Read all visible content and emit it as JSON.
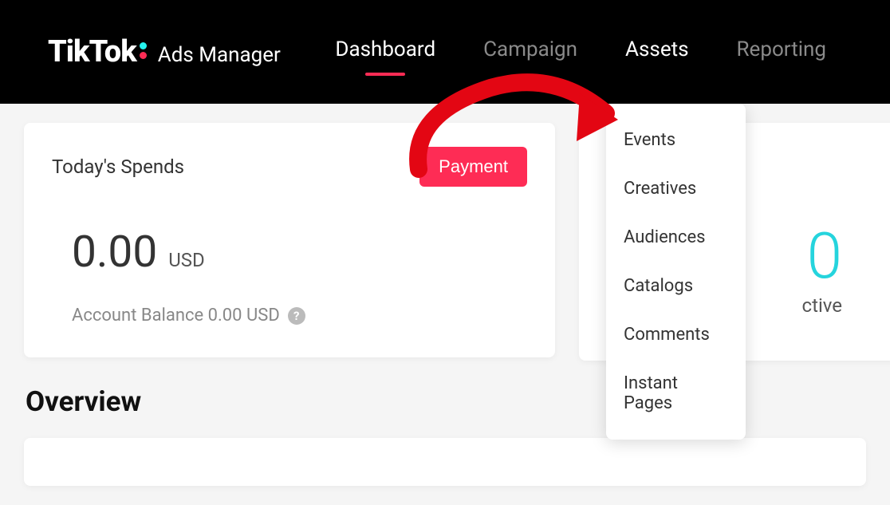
{
  "header": {
    "logo_text": "TikTok",
    "logo_subtitle": "Ads Manager",
    "nav": {
      "dashboard": "Dashboard",
      "campaign": "Campaign",
      "assets": "Assets",
      "reporting": "Reporting"
    }
  },
  "spends_card": {
    "title": "Today's Spends",
    "payment_button": "Payment",
    "amount": "0.00",
    "currency": "USD",
    "balance_label": "Account Balance 0.00 USD"
  },
  "overview": {
    "title": "Overview"
  },
  "right_card": {
    "number": "0",
    "label": "ctive"
  },
  "dropdown": {
    "items": [
      "Events",
      "Creatives",
      "Audiences",
      "Catalogs",
      "Comments",
      "Instant Pages"
    ]
  }
}
